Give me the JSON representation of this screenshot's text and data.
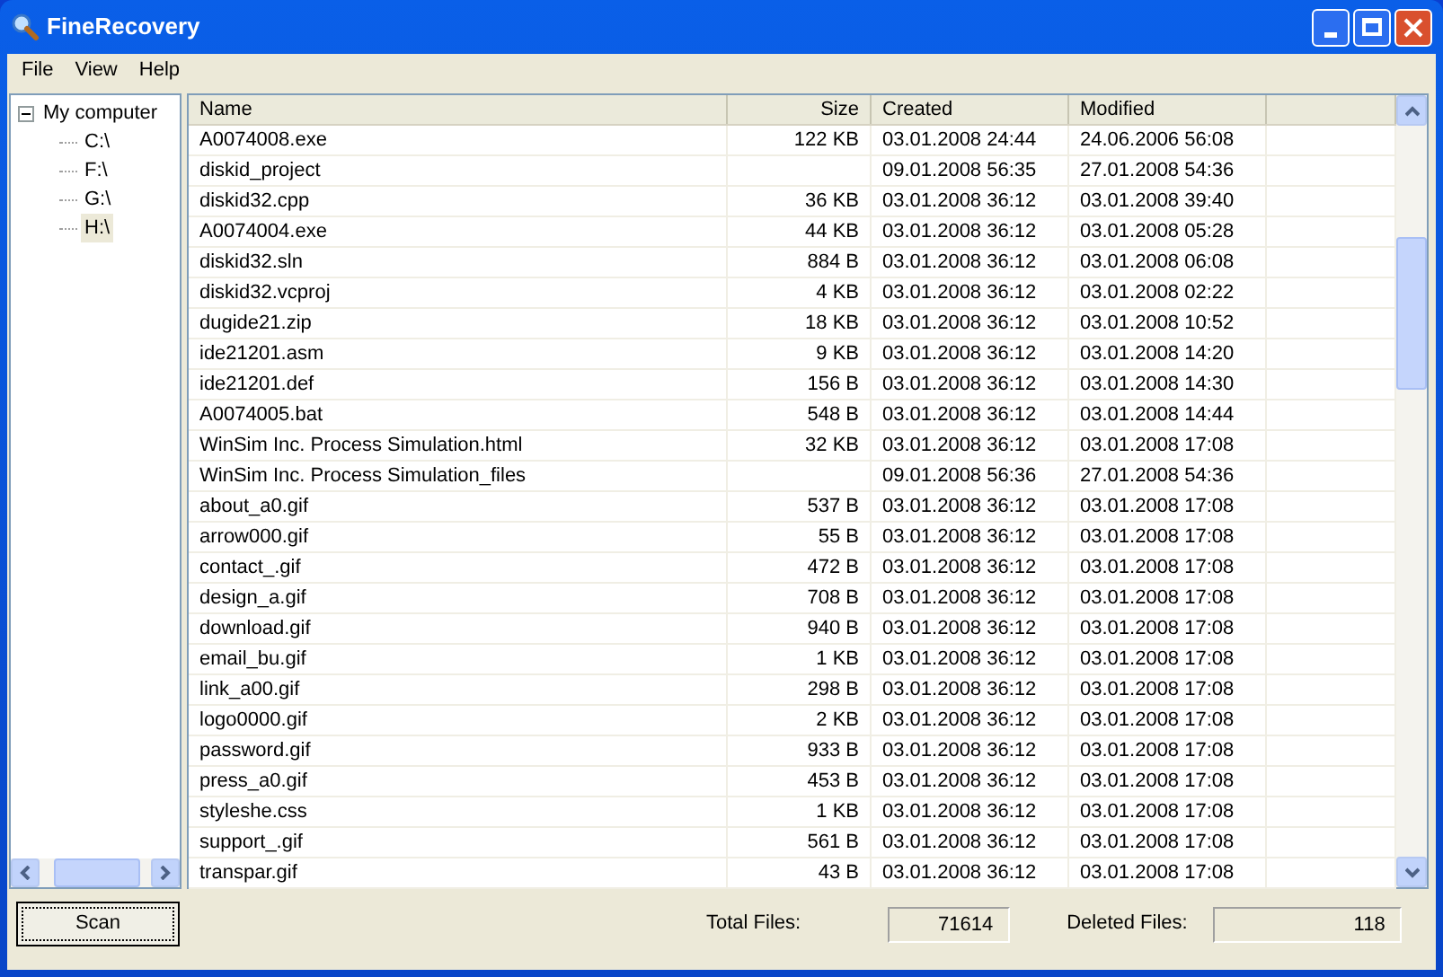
{
  "window": {
    "title": "FineRecovery"
  },
  "menu": [
    "File",
    "View",
    "Help"
  ],
  "tree": {
    "label": "My computer",
    "expanded": true,
    "children": [
      {
        "label": "C:\\",
        "selected": false
      },
      {
        "label": "F:\\",
        "selected": false
      },
      {
        "label": "G:\\",
        "selected": false
      },
      {
        "label": "H:\\",
        "selected": true
      }
    ]
  },
  "table": {
    "columns": [
      "Name",
      "Size",
      "Created",
      "Modified"
    ],
    "rows": [
      {
        "name": "A0074008.exe",
        "size": "122 KB",
        "created": "03.01.2008 24:44",
        "modified": "24.06.2006 56:08"
      },
      {
        "name": "diskid_project",
        "created": "09.01.2008 56:35",
        "modified": "27.01.2008 54:36"
      },
      {
        "name": "diskid32.cpp",
        "size": "36 KB",
        "created": "03.01.2008 36:12",
        "modified": "03.01.2008 39:40"
      },
      {
        "name": "A0074004.exe",
        "size": "44 KB",
        "created": "03.01.2008 36:12",
        "modified": "03.01.2008 05:28"
      },
      {
        "name": "diskid32.sln",
        "size": "884 B",
        "created": "03.01.2008 36:12",
        "modified": "03.01.2008 06:08"
      },
      {
        "name": "diskid32.vcproj",
        "size": "4 KB",
        "created": "03.01.2008 36:12",
        "modified": "03.01.2008 02:22"
      },
      {
        "name": "dugide21.zip",
        "size": "18 KB",
        "created": "03.01.2008 36:12",
        "modified": "03.01.2008 10:52"
      },
      {
        "name": "ide21201.asm",
        "size": "9 KB",
        "created": "03.01.2008 36:12",
        "modified": "03.01.2008 14:20"
      },
      {
        "name": "ide21201.def",
        "size": "156 B",
        "created": "03.01.2008 36:12",
        "modified": "03.01.2008 14:30"
      },
      {
        "name": "A0074005.bat",
        "size": "548 B",
        "created": "03.01.2008 36:12",
        "modified": "03.01.2008 14:44"
      },
      {
        "name": "WinSim Inc. Process Simulation.html",
        "size": "32 KB",
        "created": "03.01.2008 36:12",
        "modified": "03.01.2008 17:08"
      },
      {
        "name": "WinSim Inc. Process Simulation_files",
        "created": "09.01.2008 56:36",
        "modified": "27.01.2008 54:36"
      },
      {
        "name": "about_a0.gif",
        "size": "537 B",
        "created": "03.01.2008 36:12",
        "modified": "03.01.2008 17:08"
      },
      {
        "name": "arrow000.gif",
        "size": "55 B",
        "created": "03.01.2008 36:12",
        "modified": "03.01.2008 17:08"
      },
      {
        "name": "contact_.gif",
        "size": "472 B",
        "created": "03.01.2008 36:12",
        "modified": "03.01.2008 17:08"
      },
      {
        "name": "design_a.gif",
        "size": "708 B",
        "created": "03.01.2008 36:12",
        "modified": "03.01.2008 17:08"
      },
      {
        "name": "download.gif",
        "size": "940 B",
        "created": "03.01.2008 36:12",
        "modified": "03.01.2008 17:08"
      },
      {
        "name": "email_bu.gif",
        "size": "1 KB",
        "created": "03.01.2008 36:12",
        "modified": "03.01.2008 17:08"
      },
      {
        "name": "link_a00.gif",
        "size": "298 B",
        "created": "03.01.2008 36:12",
        "modified": "03.01.2008 17:08"
      },
      {
        "name": "logo0000.gif",
        "size": "2 KB",
        "created": "03.01.2008 36:12",
        "modified": "03.01.2008 17:08"
      },
      {
        "name": "password.gif",
        "size": "933 B",
        "created": "03.01.2008 36:12",
        "modified": "03.01.2008 17:08"
      },
      {
        "name": "press_a0.gif",
        "size": "453 B",
        "created": "03.01.2008 36:12",
        "modified": "03.01.2008 17:08"
      },
      {
        "name": "styleshe.css",
        "size": "1 KB",
        "created": "03.01.2008 36:12",
        "modified": "03.01.2008 17:08"
      },
      {
        "name": "support_.gif",
        "size": "561 B",
        "created": "03.01.2008 36:12",
        "modified": "03.01.2008 17:08"
      },
      {
        "name": "transpar.gif",
        "size": "43 B",
        "created": "03.01.2008 36:12",
        "modified": "03.01.2008 17:08"
      }
    ]
  },
  "scan_button": "Scan",
  "status": [
    {
      "label": "Total Files:",
      "value": "71614"
    },
    {
      "label": "Deleted Files:",
      "value": "118"
    }
  ]
}
